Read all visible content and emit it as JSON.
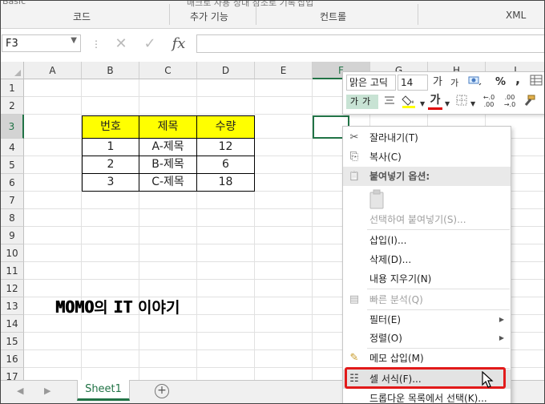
{
  "ribbon": {
    "cut_texts": [
      "Basic",
      "매크로 사용",
      "상대 참조로 기록",
      "삽입"
    ],
    "groups": [
      "코드",
      "추가 기능",
      "컨트롤",
      "XML"
    ]
  },
  "formula_bar": {
    "name_box": "F3",
    "cancel_icon": "✕",
    "enter_icon": "✓",
    "fx_label": "fx",
    "formula": ""
  },
  "grid": {
    "columns": [
      "A",
      "B",
      "C",
      "D",
      "E",
      "F",
      "G",
      "H",
      "I"
    ],
    "rows": [
      "1",
      "2",
      "3",
      "4",
      "5",
      "6",
      "7",
      "8",
      "9",
      "10",
      "11",
      "12",
      "13",
      "14",
      "15",
      "16",
      "17"
    ],
    "selected_cell": "F3"
  },
  "table": {
    "headers": [
      "번호",
      "제목",
      "수량"
    ],
    "rows": [
      [
        "1",
        "A-제목",
        "12"
      ],
      [
        "2",
        "B-제목",
        "6"
      ],
      [
        "3",
        "C-제목",
        "18"
      ]
    ],
    "header_color": "#ffff00"
  },
  "watermark": {
    "latin1": "MOMO",
    "kor1": "의 ",
    "latin2": "IT",
    "kor2": " 이야기"
  },
  "sheet_tabs": {
    "prev_icon": "◀",
    "next_icon": "▶",
    "active": "Sheet1",
    "add_icon": "+"
  },
  "mini_toolbar": {
    "font_name": "맑은 고딕",
    "font_size": "14",
    "grow_font": "가",
    "shrink_font": "가",
    "percent": "%",
    "comma": ",",
    "styles": "가가",
    "font_color_label": "가",
    "dec_increase": "←.0 .00",
    "dec_decrease": ".00 →.0"
  },
  "context_menu": {
    "items": [
      {
        "label": "잘라내기(T)",
        "icon": "scissors-icon",
        "glyph": "✂",
        "disabled": false
      },
      {
        "label": "복사(C)",
        "icon": "copy-icon",
        "glyph": "⎘",
        "disabled": false
      },
      {
        "label": "붙여넣기 옵션:",
        "icon": "paste-icon",
        "glyph": "📋",
        "header": true
      },
      {
        "label": "선택하여 붙여넣기(S)...",
        "icon": "",
        "disabled": true
      },
      {
        "label": "삽입(I)...",
        "disabled": false
      },
      {
        "label": "삭제(D)...",
        "disabled": false
      },
      {
        "label": "내용 지우기(N)",
        "disabled": false
      },
      {
        "label": "빠른 분석(Q)",
        "icon": "quick-analysis-icon",
        "glyph": "▤",
        "disabled": true
      },
      {
        "label": "필터(E)",
        "submenu": true,
        "disabled": false
      },
      {
        "label": "정렬(O)",
        "submenu": true,
        "disabled": false
      },
      {
        "label": "메모 삽입(M)",
        "icon": "comment-icon",
        "glyph": "✎",
        "disabled": false
      },
      {
        "label": "셀 서식(F)...",
        "icon": "format-cells-icon",
        "glyph": "☷",
        "disabled": false,
        "highlighted": true
      },
      {
        "label": "드롭다운 목록에서 선택(K)...",
        "disabled": false
      }
    ],
    "submenu_arrow": "▶",
    "highlight_color": "#e21a1a"
  }
}
